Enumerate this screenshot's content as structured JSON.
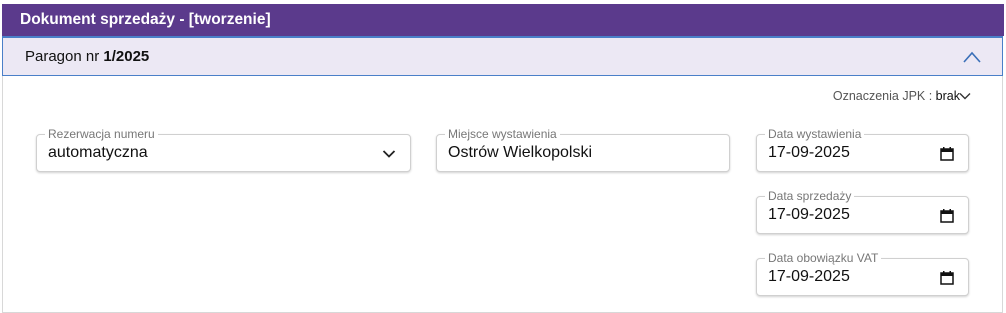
{
  "header": {
    "title": "Dokument sprzedaży - [tworzenie]"
  },
  "section": {
    "label_prefix": "Paragon nr ",
    "number": "1/2025",
    "collapse_icon": "chevron-up-icon"
  },
  "jpk": {
    "label": "Oznaczenia JPK : ",
    "value": "brak",
    "icon": "chevron-down-icon"
  },
  "fields": {
    "reservation": {
      "label": "Rezerwacja numeru",
      "value": "automatyczna",
      "icon": "chevron-down-icon"
    },
    "place": {
      "label": "Miejsce wystawienia",
      "value": "Ostrów Wielkopolski"
    },
    "issue_date": {
      "label": "Data wystawienia",
      "value": "17-09-2025",
      "icon": "calendar-icon"
    },
    "sale_date": {
      "label": "Data sprzedaży",
      "value": "17-09-2025",
      "icon": "calendar-icon"
    },
    "vat_date": {
      "label": "Data obowiązku VAT",
      "value": "17-09-2025",
      "icon": "calendar-icon"
    }
  },
  "colors": {
    "titlebar": "#5b3a8c",
    "section_bg": "#ece8f4",
    "accent": "#4a7fc8"
  }
}
